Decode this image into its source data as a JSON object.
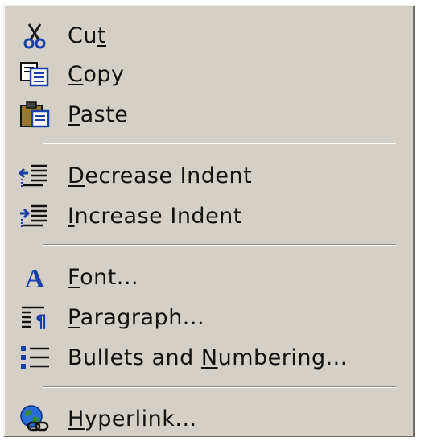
{
  "menu": {
    "items": [
      {
        "pre": "Cu",
        "key": "t",
        "post": ""
      },
      {
        "pre": "",
        "key": "C",
        "post": "opy"
      },
      {
        "pre": "",
        "key": "P",
        "post": "aste"
      },
      {
        "pre": "",
        "key": "D",
        "post": "ecrease Indent"
      },
      {
        "pre": "",
        "key": "I",
        "post": "ncrease Indent"
      },
      {
        "pre": "",
        "key": "F",
        "post": "ont..."
      },
      {
        "pre": "",
        "key": "P",
        "post": "aragraph..."
      },
      {
        "pre": "Bullets and ",
        "key": "N",
        "post": "umbering..."
      },
      {
        "pre": "",
        "key": "H",
        "post": "yperlink..."
      }
    ]
  },
  "icons": [
    "scissors-icon",
    "copy-icon",
    "paste-icon",
    "decrease-indent-icon",
    "increase-indent-icon",
    "font-icon",
    "paragraph-icon",
    "bullets-icon",
    "hyperlink-icon"
  ],
  "colors": {
    "menu_bg": "#d4d0c8",
    "icon_blue": "#1a3fa8",
    "text": "#111111"
  }
}
